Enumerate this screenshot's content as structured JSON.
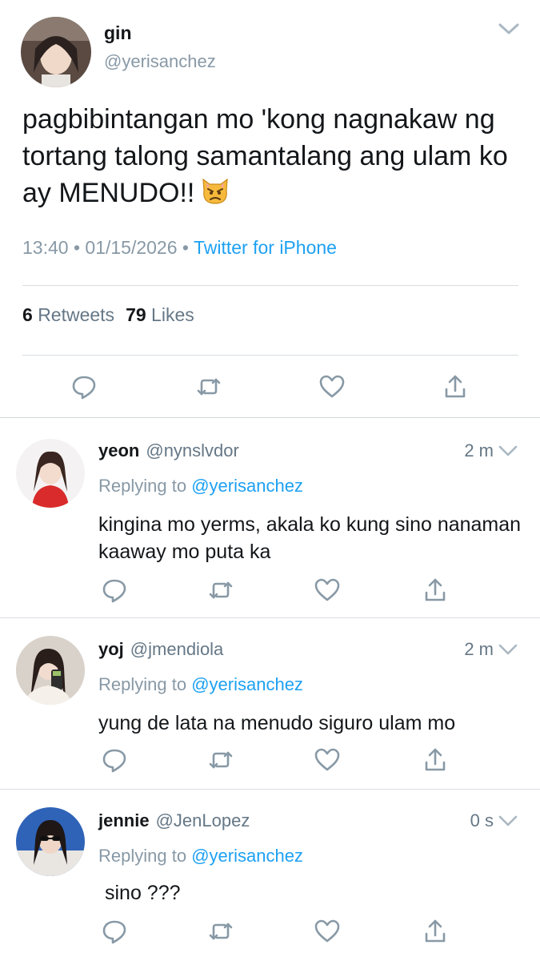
{
  "main_tweet": {
    "author_name": "gin",
    "author_handle": "@yerisanchez",
    "text": "pagbibintangan mo 'kong nagnakaw ng tortang talong samantalang ang ulam ko ay MENUDO!!",
    "emoji": "pouting-cat-face-icon",
    "time": "13:40",
    "date": "01/15/2026",
    "separator": "•",
    "source": "Twitter for iPhone",
    "retweets_count": "6",
    "retweets_label": "Retweets",
    "likes_count": "79",
    "likes_label": "Likes"
  },
  "replies": [
    {
      "author_name": "yeon",
      "author_handle": "@nynslvdor",
      "time": "2 m",
      "replying_prefix": "Replying to",
      "replying_to": "@yerisanchez",
      "text": "kingina mo yerms, akala ko kung sino nanaman kaaway mo puta ka"
    },
    {
      "author_name": "yoj",
      "author_handle": "@jmendiola",
      "time": "2 m",
      "replying_prefix": "Replying to",
      "replying_to": "@yerisanchez",
      "text": "yung de lata na menudo siguro ulam mo"
    },
    {
      "author_name": "jennie",
      "author_handle": "@JenLopez",
      "time": "0 s",
      "replying_prefix": "Replying to",
      "replying_to": "@yerisanchez",
      "text": "sino ???"
    }
  ],
  "icons": [
    "reply-icon",
    "retweet-icon",
    "like-icon",
    "share-icon",
    "chevron-down-icon"
  ],
  "colors": {
    "text": "#14171a",
    "secondary": "#657786",
    "muted": "#8899a6",
    "link": "#1da1f2",
    "divider": "#d9dde1"
  }
}
